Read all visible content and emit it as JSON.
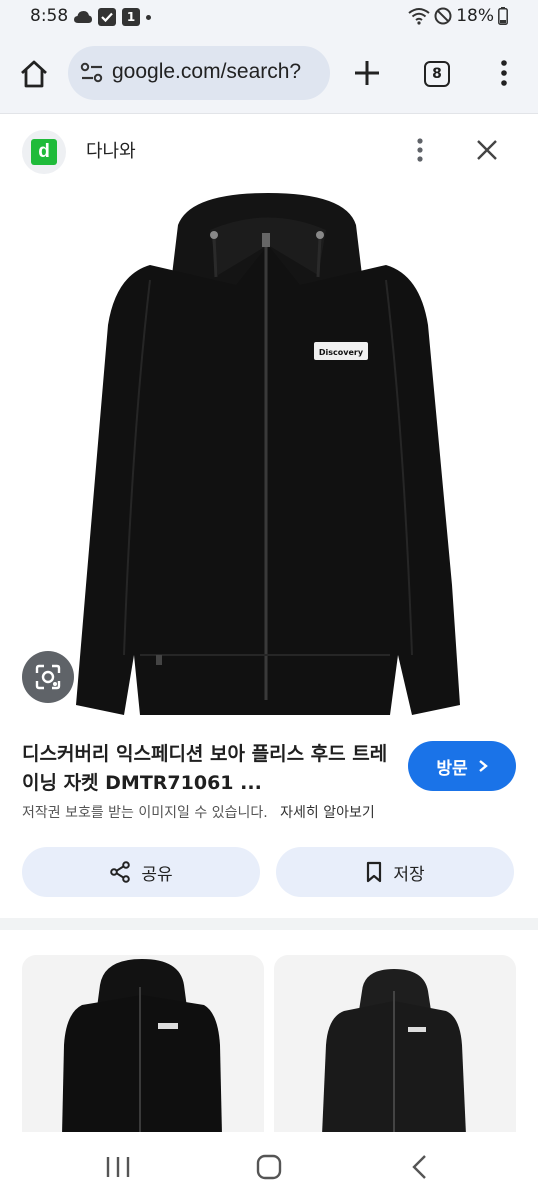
{
  "status_bar": {
    "time": "8:58",
    "notification_badge": "1",
    "battery": "18%"
  },
  "browser": {
    "url": "google.com/search?",
    "tab_count": "8"
  },
  "source": {
    "favicon_letter": "d",
    "name": "다나와",
    "brand_color": "#1fbb3a"
  },
  "product": {
    "image_logo_text": "Discovery",
    "title": "디스커버리 익스페디션 보아 플리스 후드 트레이닝 자켓 DMTR71061 ...",
    "visit_label": "방문",
    "copyright_notice": "저작권 보호를 받는 이미지일 수 있습니다.",
    "learn_more": "자세히 알아보기"
  },
  "actions": {
    "share_label": "공유",
    "save_label": "저장"
  },
  "colors": {
    "accent": "#1a73e8",
    "action_bg": "#e8eefa",
    "toolbar_bg": "#f2f4f8"
  },
  "icons": [
    "home-icon",
    "tune-icon",
    "plus-icon",
    "tabs-icon",
    "more-vert-icon",
    "close-icon",
    "lens-icon",
    "chevron-right-icon",
    "share-icon",
    "bookmark-icon",
    "recents-icon",
    "nav-home-icon",
    "back-icon"
  ]
}
